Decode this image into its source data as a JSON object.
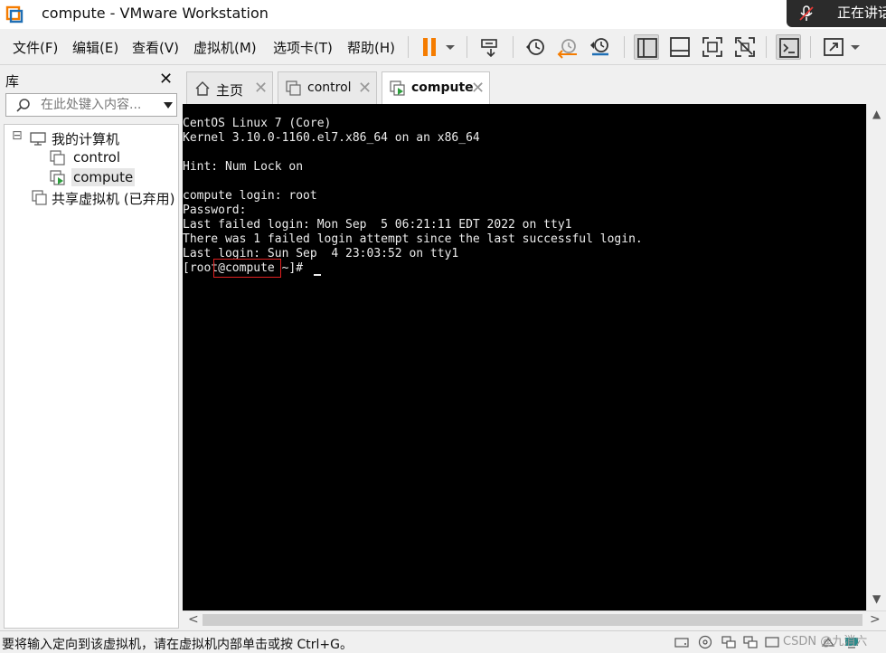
{
  "window": {
    "title": "compute - VMware Workstation",
    "screen_share_label": "正在讲话"
  },
  "menu": {
    "items": [
      "文件(F)",
      "编辑(E)",
      "查看(V)",
      "虚拟机(M)",
      "选项卡(T)",
      "帮助(H)"
    ]
  },
  "toolbar": {
    "icons": [
      "pause-icon",
      "dropdown-arrow-icon",
      "send-ctrl-alt-del-icon",
      "snapshot-icon",
      "revert-snapshot-icon",
      "snapshot-manager-icon",
      "show-library-icon",
      "thumbnail-bar-icon",
      "fullscreen-icon",
      "unity-icon",
      "console-view-icon",
      "stretch-view-icon",
      "stretch-dropdown-icon"
    ],
    "accent_color": "#f57c00"
  },
  "library": {
    "header": "库",
    "close_glyph": "✕",
    "search_placeholder": "在此处键入内容...",
    "tree": {
      "root_toggle": "⊟",
      "root_label": "我的计算机",
      "vms": [
        "control",
        "compute"
      ],
      "selected_vm": "compute",
      "shared_label": "共享虚拟机 (已弃用)"
    }
  },
  "tabs": [
    {
      "label": "主页",
      "icon": "home-icon",
      "active": false
    },
    {
      "label": "control",
      "icon": "vm-icon",
      "active": false
    },
    {
      "label": "compute",
      "icon": "vm-running-icon",
      "active": true
    }
  ],
  "tab_close_glyph": "✕",
  "console": {
    "lines": [
      "CentOS Linux 7 (Core)",
      "Kernel 3.10.0-1160.el7.x86_64 on an x86_64",
      "",
      "Hint: Num Lock on",
      "",
      "compute login: root",
      "Password:",
      "Last failed login: Mon Sep  5 06:21:11 EDT 2022 on tty1",
      "There was 1 failed login attempt since the last successful login.",
      "Last login: Sun Sep  4 23:03:52 on tty1",
      "[root@compute ~]# "
    ],
    "text_color": "#ececec",
    "background": "#000000",
    "highlight_color": "#e02020"
  },
  "status": {
    "message": "要将输入定向到该虚拟机，请在虚拟机内部单击或按 Ctrl+G。",
    "icons": [
      "hard-disk-icon",
      "cd-rom-icon",
      "network-icon",
      "usb-icon",
      "sound-icon",
      "printer-icon",
      "display-icon"
    ],
    "watermark": "CSDN @九消六"
  },
  "scroll": {
    "up": "▲",
    "down": "▼",
    "left": "<",
    "right": ">"
  }
}
